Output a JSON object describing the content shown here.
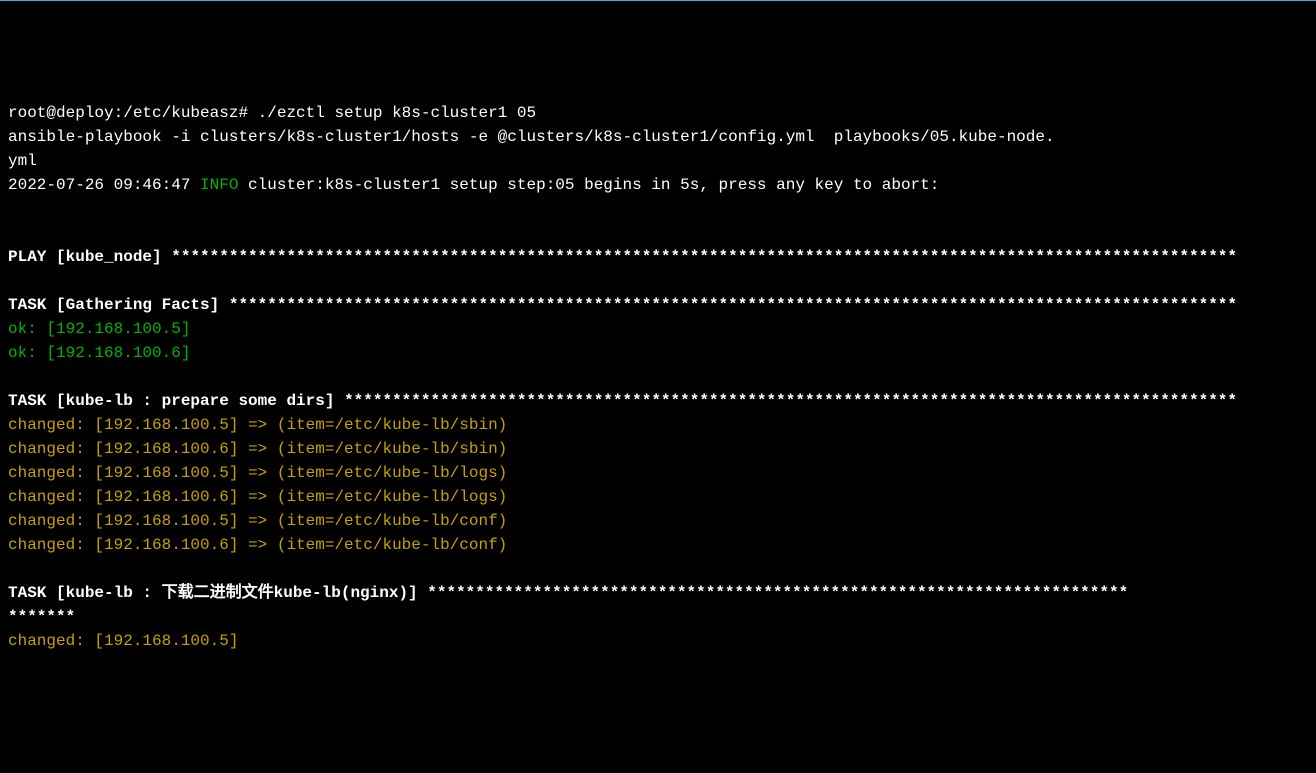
{
  "prompt": "root@deploy:/etc/kubeasz# ",
  "command": "./ezctl setup k8s-cluster1 05",
  "line2": "ansible-playbook -i clusters/k8s-cluster1/hosts -e @clusters/k8s-cluster1/config.yml  playbooks/05.kube-node.",
  "line3": "yml",
  "ts": "2022-07-26 09:46:47 ",
  "info": "INFO",
  "info_msg": " cluster:k8s-cluster1 setup step:05 begins in 5s, press any key to abort:",
  "play_hdr": "PLAY [kube_node] ",
  "play_stars": "***************************************************************************************************************",
  "task1_hdr": "TASK [Gathering Facts] ",
  "task1_stars": "*********************************************************************************************************",
  "ok1": "ok: [192.168.100.5]",
  "ok2": "ok: [192.168.100.6]",
  "task2_hdr": "TASK [kube-lb : prepare some dirs] ",
  "task2_stars": "*********************************************************************************************",
  "ch1": "changed: [192.168.100.5] => (item=/etc/kube-lb/sbin)",
  "ch2": "changed: [192.168.100.6] => (item=/etc/kube-lb/sbin)",
  "ch3": "changed: [192.168.100.5] => (item=/etc/kube-lb/logs)",
  "ch4": "changed: [192.168.100.6] => (item=/etc/kube-lb/logs)",
  "ch5": "changed: [192.168.100.5] => (item=/etc/kube-lb/conf)",
  "ch6": "changed: [192.168.100.6] => (item=/etc/kube-lb/conf)",
  "task3_hdr": "TASK [kube-lb : 下载二进制文件kube-lb(nginx)] ",
  "task3_stars": "*************************************************************************",
  "task3_stars2": "*******",
  "ch7": "changed: [192.168.100.5]"
}
